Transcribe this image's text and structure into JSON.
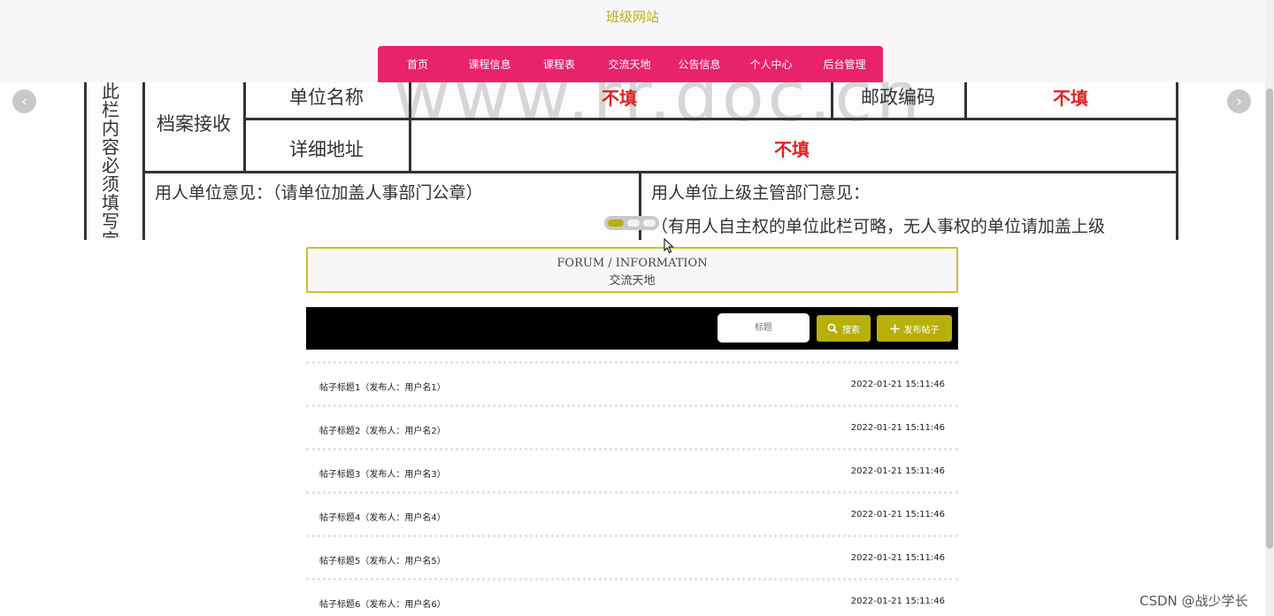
{
  "header": {
    "site_title": "班级网站",
    "nav": [
      "首页",
      "课程信息",
      "课程表",
      "交流天地",
      "公告信息",
      "个人中心",
      "后台管理"
    ],
    "accent_color": "#e8236a",
    "brand_color": "#b7b00a"
  },
  "banner": {
    "arrow_left": "‹",
    "arrow_right": "›",
    "slide_count": 3,
    "active_slide": 1,
    "doc": {
      "watermark": "www.rr.doc.cn",
      "vertical_label": "此栏内容必须填写完",
      "archive_label": "档案接收",
      "unit_name_label": "单位名称",
      "unit_name_value": "不填",
      "postal_code_label": "邮政编码",
      "postal_code_value": "不填",
      "address_label": "详细地址",
      "address_value": "不填",
      "employer_opinion": "用人单位意见：（请单位加盖人事部门公章）",
      "supervisor_opinion": "用人单位上级主管部门意见：",
      "supervisor_note": "（有用人自主权的单位此栏可略，无人事权的单位请加盖上级"
    }
  },
  "section": {
    "title_en": "FORUM / INFORMATION",
    "title_cn": "交流天地"
  },
  "search": {
    "placeholder": "标题",
    "search_button": "搜索",
    "post_button": "发布帖子",
    "search_icon": "search-icon",
    "post_icon": "plus-icon"
  },
  "posts": [
    {
      "title": "帖子标题1（发布人：用户名1）",
      "time": "2022-01-21 15:11:46"
    },
    {
      "title": "帖子标题2（发布人：用户名2）",
      "time": "2022-01-21 15:11:46"
    },
    {
      "title": "帖子标题3（发布人：用户名3）",
      "time": "2022-01-21 15:11:46"
    },
    {
      "title": "帖子标题4（发布人：用户名4）",
      "time": "2022-01-21 15:11:46"
    },
    {
      "title": "帖子标题5（发布人：用户名5）",
      "time": "2022-01-21 15:11:46"
    },
    {
      "title": "帖子标题6（发布人：用户名6）",
      "time": "2022-01-21 15:11:46"
    }
  ],
  "watermark_text": "CSDN @战少学长"
}
